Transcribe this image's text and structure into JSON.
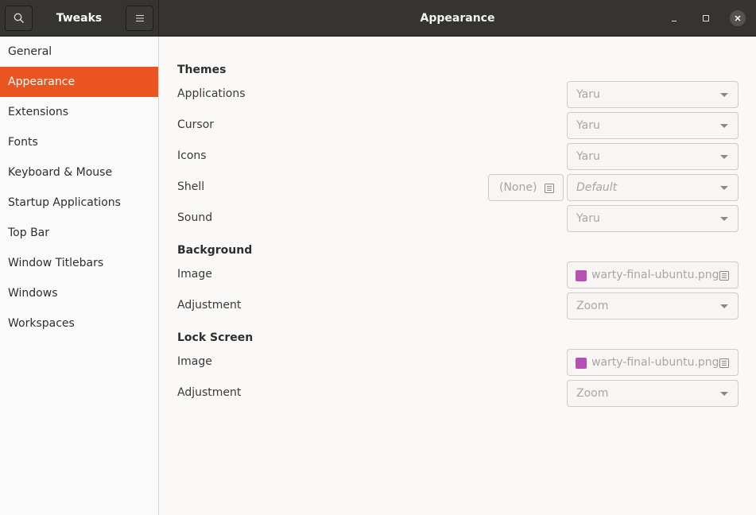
{
  "header": {
    "app_title": "Tweaks",
    "page_title": "Appearance"
  },
  "sidebar": {
    "items": [
      {
        "label": "General"
      },
      {
        "label": "Appearance",
        "active": true
      },
      {
        "label": "Extensions"
      },
      {
        "label": "Fonts"
      },
      {
        "label": "Keyboard & Mouse"
      },
      {
        "label": "Startup Applications"
      },
      {
        "label": "Top Bar"
      },
      {
        "label": "Window Titlebars"
      },
      {
        "label": "Windows"
      },
      {
        "label": "Workspaces"
      }
    ]
  },
  "themes": {
    "title": "Themes",
    "applications": {
      "label": "Applications",
      "value": "Yaru"
    },
    "cursor": {
      "label": "Cursor",
      "value": "Yaru"
    },
    "icons": {
      "label": "Icons",
      "value": "Yaru"
    },
    "shell": {
      "label": "Shell",
      "file_value": "(None)",
      "value": "Default"
    },
    "sound": {
      "label": "Sound",
      "value": "Yaru"
    }
  },
  "background": {
    "title": "Background",
    "image": {
      "label": "Image",
      "value": "warty-final-ubuntu.png"
    },
    "adjustment": {
      "label": "Adjustment",
      "value": "Zoom"
    }
  },
  "lock_screen": {
    "title": "Lock Screen",
    "image": {
      "label": "Image",
      "value": "warty-final-ubuntu.png"
    },
    "adjustment": {
      "label": "Adjustment",
      "value": "Zoom"
    }
  },
  "colors": {
    "accent": "#e95420",
    "headerbar": "#353431",
    "image_icon": "#b84fb3"
  },
  "icons": {
    "search": "search-icon",
    "menu": "hamburger-menu-icon",
    "minimize": "minimize-icon",
    "maximize": "maximize-icon",
    "close": "close-icon",
    "file": "document-icon",
    "image": "image-icon"
  }
}
